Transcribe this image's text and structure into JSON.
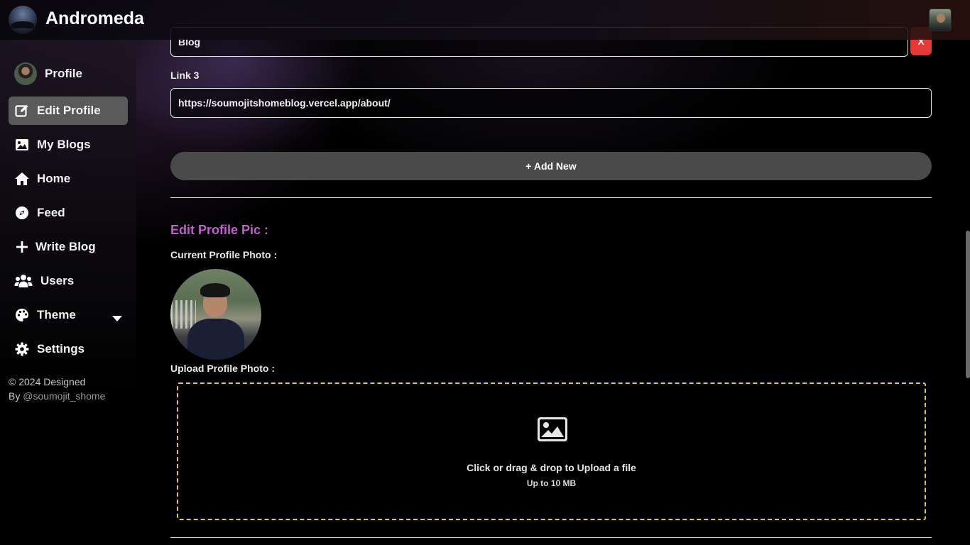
{
  "app": {
    "name": "Andromeda"
  },
  "sidebar": {
    "items": [
      {
        "label": "Profile",
        "icon": "profile-avatar"
      },
      {
        "label": "Edit Profile",
        "icon": "edit-icon",
        "active": true
      },
      {
        "label": "My Blogs",
        "icon": "image-icon"
      },
      {
        "label": "Home",
        "icon": "home-icon"
      },
      {
        "label": "Feed",
        "icon": "compass-icon"
      },
      {
        "label": "Write Blog",
        "icon": "plus-icon"
      },
      {
        "label": "Users",
        "icon": "users-icon"
      },
      {
        "label": "Theme",
        "icon": "palette-icon"
      },
      {
        "label": "Settings",
        "icon": "gear-icon"
      }
    ],
    "footer": {
      "line1": "© 2024 Designed",
      "line2_prefix": "By ",
      "handle": "@soumojit_shome"
    }
  },
  "links": {
    "link2_value": "Blog",
    "remove_label": "X",
    "link3_label": "Link 3",
    "link3_value": "https://soumojitshomeblog.vercel.app/about/",
    "add_new_label": "+ Add New"
  },
  "profile_pic": {
    "section_title": "Edit Profile Pic :",
    "current_label": "Current Profile Photo :",
    "upload_label": "Upload Profile Photo :",
    "dropzone_main": "Click or drag & drop to Upload a file",
    "dropzone_sub": "Up to 10 MB"
  },
  "colors": {
    "accent_title": "#c35fd0",
    "remove_button": "#e53935",
    "dropzone_border": "#f2c230",
    "active_nav": "#5a5a5a"
  }
}
